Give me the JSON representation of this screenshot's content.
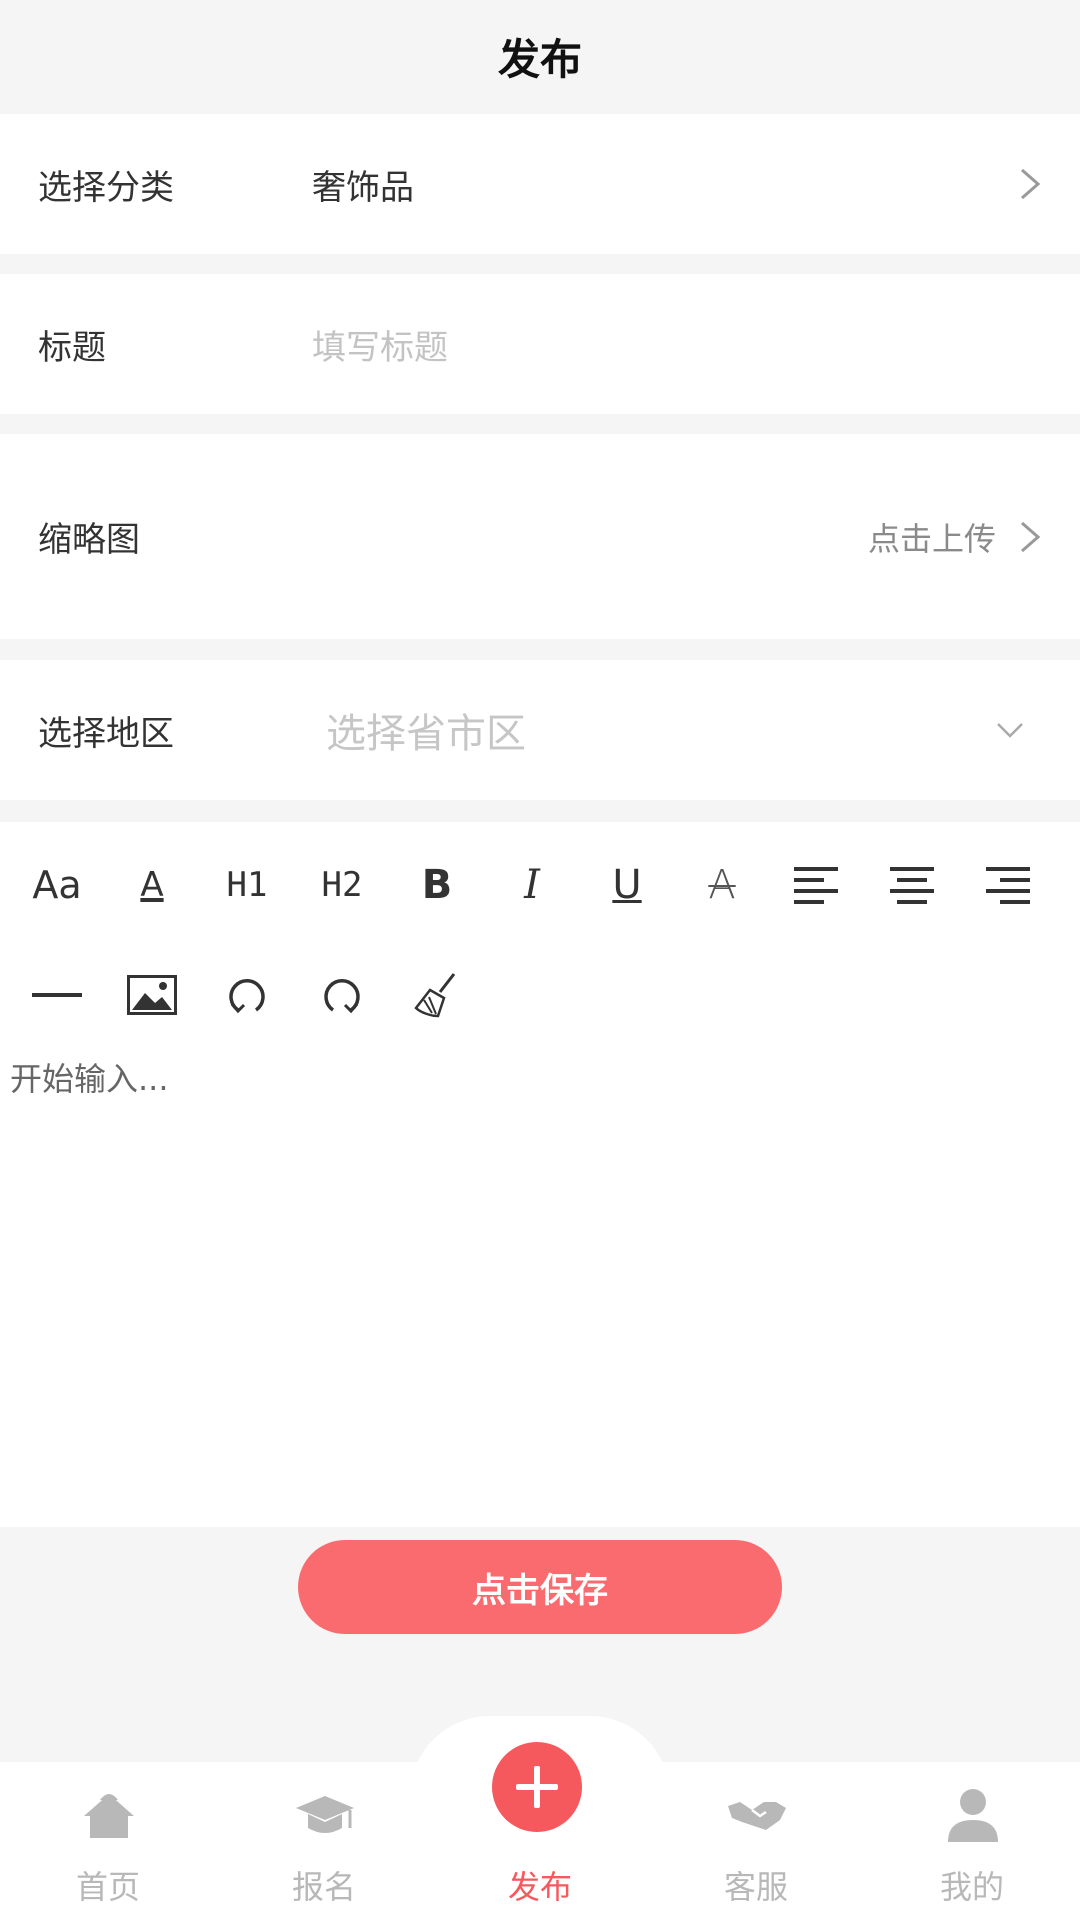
{
  "header": {
    "title": "发布"
  },
  "form": {
    "category": {
      "label": "选择分类",
      "value": "奢饰品"
    },
    "title": {
      "label": "标题",
      "placeholder": "填写标题"
    },
    "thumbnail": {
      "label": "缩略图",
      "action": "点击上传"
    },
    "region": {
      "label": "选择地区",
      "placeholder": "选择省市区"
    }
  },
  "editor": {
    "toolbar": [
      {
        "name": "font-size-icon",
        "label": "Aa"
      },
      {
        "name": "font-color-icon",
        "label": "A"
      },
      {
        "name": "heading-1-icon",
        "label": "H1"
      },
      {
        "name": "heading-2-icon",
        "label": "H2"
      },
      {
        "name": "bold-icon",
        "label": "B"
      },
      {
        "name": "italic-icon",
        "label": "I"
      },
      {
        "name": "underline-icon",
        "label": "U"
      },
      {
        "name": "strikethrough-icon",
        "label": "A"
      },
      {
        "name": "align-left-icon"
      },
      {
        "name": "align-center-icon"
      },
      {
        "name": "align-right-icon"
      },
      {
        "name": "horizontal-rule-icon"
      },
      {
        "name": "image-icon"
      },
      {
        "name": "undo-icon"
      },
      {
        "name": "redo-icon"
      },
      {
        "name": "clear-format-icon"
      }
    ],
    "placeholder": "开始输入..."
  },
  "actions": {
    "save_label": "点击保存"
  },
  "tabbar": {
    "items": [
      {
        "label": "首页",
        "icon": "home-icon"
      },
      {
        "label": "报名",
        "icon": "graduation-cap-icon"
      },
      {
        "label": "发布",
        "icon": "plus-icon",
        "active": true
      },
      {
        "label": "客服",
        "icon": "handshake-icon"
      },
      {
        "label": "我的",
        "icon": "user-icon"
      }
    ]
  },
  "colors": {
    "accent": "#f96b6e",
    "active_tab": "#f5595d",
    "inactive_tab": "#b8b8b8"
  }
}
